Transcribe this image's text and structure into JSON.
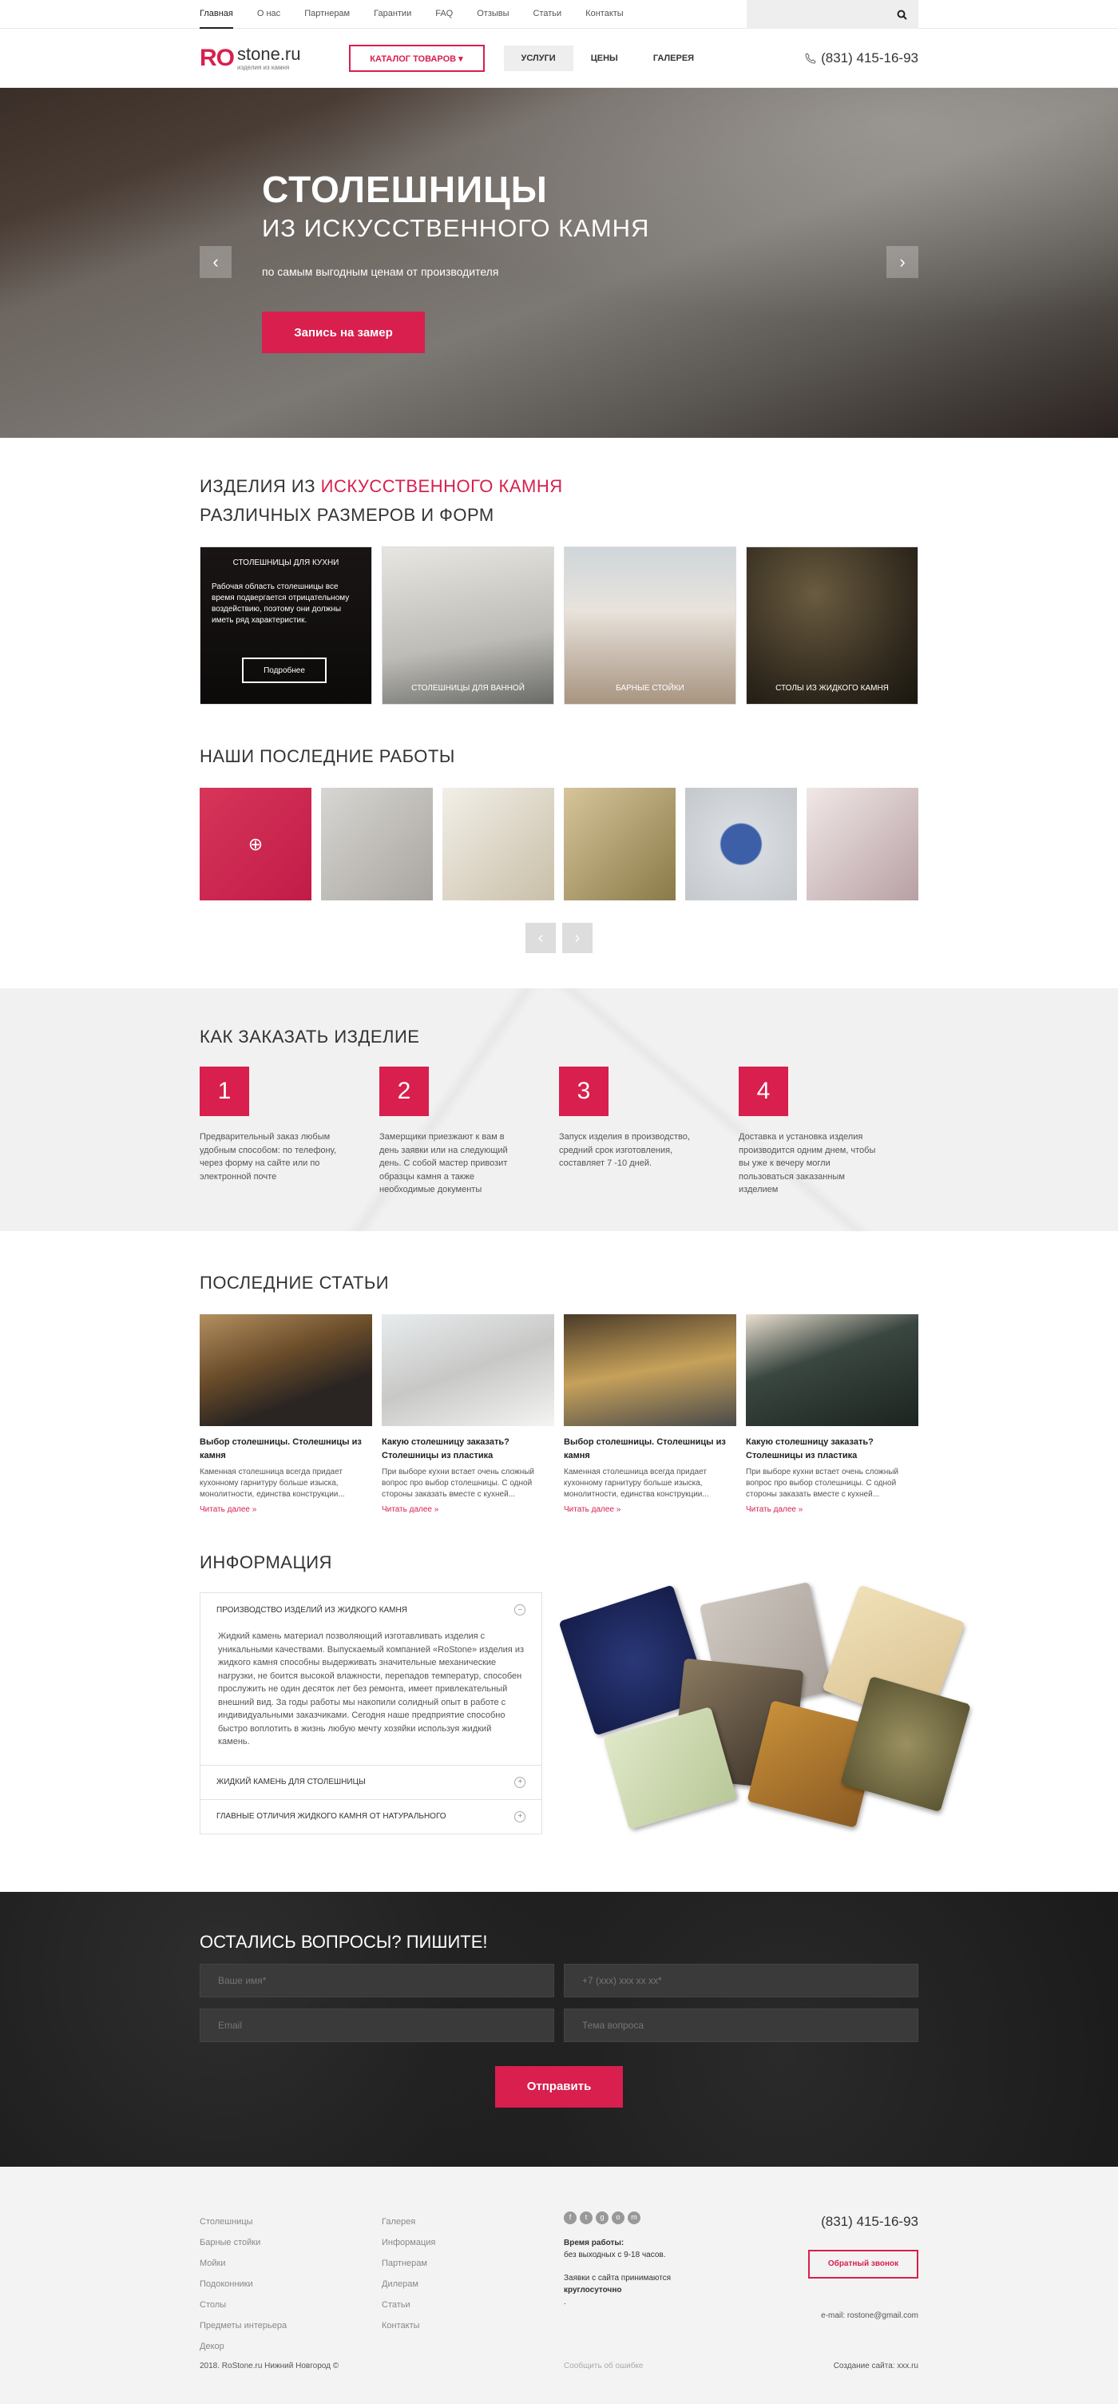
{
  "topnav": {
    "items": [
      "Главная",
      "О нас",
      "Партнерам",
      "Гарантии",
      "FAQ",
      "Отзывы",
      "Статьи",
      "Контакты"
    ]
  },
  "search": {
    "placeholder": ""
  },
  "header": {
    "logo_ro": "RO",
    "logo_site": "stone.ru",
    "logo_sub": "изделия из камня",
    "catalog_btn": "Каталог товаров ▾",
    "nav": [
      "Услуги",
      "Цены",
      "Галерея"
    ],
    "phone": "(831) 415-16-93"
  },
  "hero": {
    "title": "СТОЛЕШНИЦЫ",
    "subtitle": "ИЗ ИСКУССТВЕННОГО КАМНЯ",
    "text": "по самым выгодным ценам от производителя",
    "button": "Запись на замер",
    "prev": "‹",
    "next": "›"
  },
  "products": {
    "title_a": "Изделия из",
    "title_b": "искусственного камня",
    "title2": "различных размеров и форм",
    "cards": [
      {
        "label": "Столешницы для кухни",
        "text": "Рабочая область столешницы все время подвергается отрицательному воздействию, поэтому они должны иметь ряд характеристик.",
        "button": "Подробнее"
      },
      {
        "label": "Столешницы для ванной"
      },
      {
        "label": "Барные стойки"
      },
      {
        "label": "Столы из жидкого камня"
      }
    ]
  },
  "works": {
    "title": "Наши последние работы",
    "prev": "‹",
    "next": "›"
  },
  "order": {
    "title": "Как заказать изделие",
    "steps": [
      {
        "num": "1",
        "text": "Предварительный заказ любым удобным способом: по телефону, через форму на сайте или по электронной почте"
      },
      {
        "num": "2",
        "text": "Замерщики приезжают к вам в день заявки или на следующий день. С собой мастер привозит образцы камня а также необходимые документы"
      },
      {
        "num": "3",
        "text": "Запуск изделия в производство, средний срок изготовления, составляет 7 -10 дней."
      },
      {
        "num": "4",
        "text": "Доставка и установка изделия производится одним днем, чтобы вы уже к вечеру могли пользоваться заказанным изделием"
      }
    ]
  },
  "articles": {
    "title": "Последние статьи",
    "items": [
      {
        "title": "Выбор столешницы. Столешницы из камня",
        "text": "Каменная столешница всегда придает кухонному гарнитуру больше изыска, монолитности, единства конструкции...",
        "more": "Читать далее »"
      },
      {
        "title": "Какую столешницу заказать? Столешницы из пластика",
        "text": "При выборе кухни встает очень сложный вопрос про выбор столешницы. С одной стороны заказать вместе с кухней...",
        "more": "Читать далее »"
      },
      {
        "title": "Выбор столешницы. Столешницы из камня",
        "text": "Каменная столешница всегда придает кухонному гарнитуру больше изыска, монолитности, единства конструкции...",
        "more": "Читать далее »"
      },
      {
        "title": "Какую столешницу заказать? Столешницы из пластика",
        "text": "При выборе кухни встает очень сложный вопрос про выбор столешницы. С одной стороны заказать вместе с кухней...",
        "more": "Читать далее »"
      }
    ]
  },
  "info": {
    "title": "Информация",
    "items": [
      {
        "head": "Производство изделий из жидкого камня",
        "icon": "−",
        "body": "Жидкий камень материал позволяющий изготавливать изделия с уникальными качествами. Выпускаемый компанией «RoStone» изделия из жидкого камня способны выдерживать значительные механические нагрузки, не боится высокой влажности, перепадов температур, способен прослужить не один десяток лет без ремонта, имеет привлекательный внешний вид. За годы работы мы накопили солидный опыт в работе с индивидуальными заказчиками. Сегодня наше предприятие способно быстро воплотить в жизнь любую мечту хозяйки используя жидкий камень."
      },
      {
        "head": "Жидкий камень для столешницы",
        "icon": "+"
      },
      {
        "head": "Главные отличия жидкого камня от натурального",
        "icon": "+"
      }
    ]
  },
  "contact": {
    "title": "Остались вопросы? Пишите!",
    "name_ph": "Ваше имя*",
    "phone_ph": "+7 (xxx) xxx xx xx*",
    "email_ph": "Email",
    "topic_ph": "Тема вопроса",
    "button": "Отправить"
  },
  "footer": {
    "col1": [
      "Столешницы",
      "Барные стойки",
      "Мойки",
      "Подоконники",
      "Столы",
      "Предметы интерьера",
      "Декор"
    ],
    "col2": [
      "Галерея",
      "Информация",
      "Партнерам",
      "Дилерам",
      "Статьи",
      "Контакты"
    ],
    "socials": [
      "f",
      "t",
      "g",
      "o",
      "m"
    ],
    "hours_label": "Время работы:",
    "hours": "без выходных с 9-18 часов.",
    "requests_a": "Заявки с сайта принимаются ",
    "requests_b": "круглосуточно",
    "requests_c": ".",
    "phone": "(831) 415-16-93",
    "callback": "Обратный звонок",
    "email": "e-mail: rostone@gmail.com",
    "copyright": "2018. RoStone.ru Нижний Новгород ©",
    "report": "Сообщить об ошибке",
    "made": "Создание сайта: xxx.ru"
  }
}
